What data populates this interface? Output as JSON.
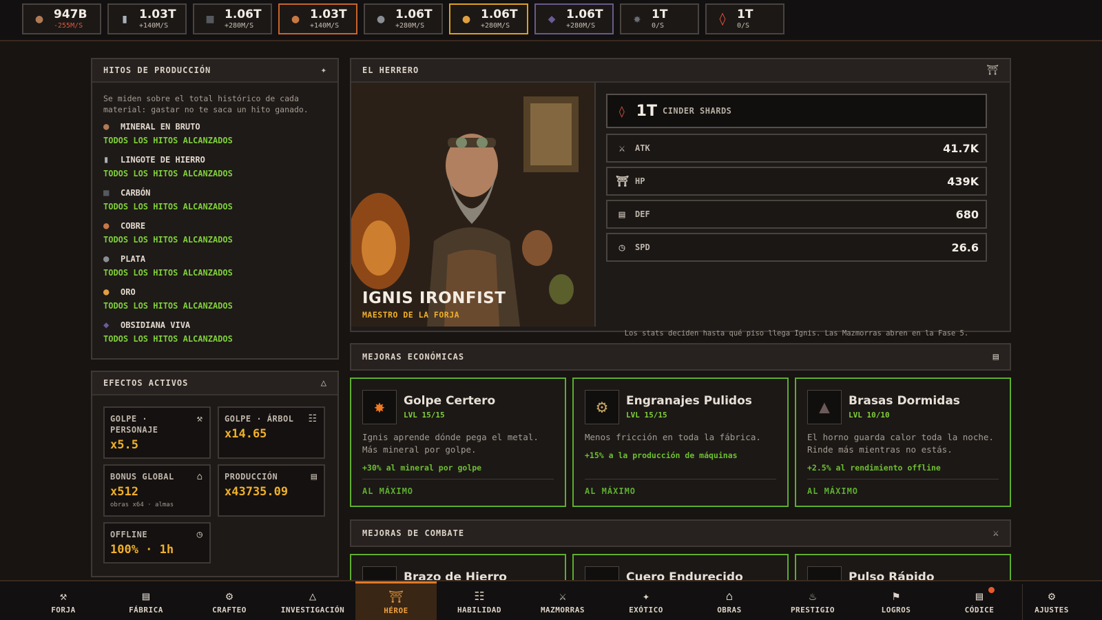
{
  "resources": [
    {
      "icon": "raw-ore-icon",
      "amount": "947B",
      "rate": "-255M/S",
      "negative": true,
      "border": "#4a4440"
    },
    {
      "icon": "iron-ingot-icon",
      "amount": "1.03T",
      "rate": "+140M/S",
      "negative": false,
      "border": "#4a4440"
    },
    {
      "icon": "coal-icon",
      "amount": "1.06T",
      "rate": "+280M/S",
      "negative": false,
      "border": "#4a4440"
    },
    {
      "icon": "copper-icon",
      "amount": "1.03T",
      "rate": "+140M/S",
      "negative": false,
      "border": "#c9642a"
    },
    {
      "icon": "silver-icon",
      "amount": "1.06T",
      "rate": "+280M/S",
      "negative": false,
      "border": "#4a4440"
    },
    {
      "icon": "gold-icon",
      "amount": "1.06T",
      "rate": "+280M/S",
      "negative": false,
      "border": "#e0a020"
    },
    {
      "icon": "obsidian-icon",
      "amount": "1.06T",
      "rate": "+280M/S",
      "negative": false,
      "border": "#6a5a8a"
    },
    {
      "icon": "gear-shard-icon",
      "amount": "1T",
      "rate": "0/S",
      "negative": false,
      "border": "#4a4440"
    },
    {
      "icon": "cinder-shard-icon",
      "amount": "1T",
      "rate": "0/S",
      "negative": false,
      "border": "#4a4440"
    }
  ],
  "milestones": {
    "title": "HITOS DE PRODUCCIÓN",
    "note": "Se miden sobre el total histórico de cada material: gastar no te saca un hito ganado.",
    "items": [
      {
        "name": "MINERAL EN BRUTO",
        "status": "TODOS LOS HITOS ALCANZADOS"
      },
      {
        "name": "LINGOTE DE HIERRO",
        "status": "TODOS LOS HITOS ALCANZADOS"
      },
      {
        "name": "CARBÓN",
        "status": "TODOS LOS HITOS ALCANZADOS"
      },
      {
        "name": "COBRE",
        "status": "TODOS LOS HITOS ALCANZADOS"
      },
      {
        "name": "PLATA",
        "status": "TODOS LOS HITOS ALCANZADOS"
      },
      {
        "name": "ORO",
        "status": "TODOS LOS HITOS ALCANZADOS"
      },
      {
        "name": "OBSIDIANA VIVA",
        "status": "TODOS LOS HITOS ALCANZADOS"
      }
    ]
  },
  "effects": {
    "title": "EFECTOS ACTIVOS",
    "items": [
      {
        "label": "GOLPE · PERSONAJE",
        "value": "x5.5",
        "sub": ""
      },
      {
        "label": "GOLPE · ÁRBOL",
        "value": "x14.65",
        "sub": ""
      },
      {
        "label": "BONUS GLOBAL",
        "value": "x512",
        "sub": "obras x64 · almas"
      },
      {
        "label": "PRODUCCIÓN",
        "value": "x43735.09",
        "sub": ""
      },
      {
        "label": "OFFLINE",
        "value": "100% · 1h",
        "sub": ""
      }
    ]
  },
  "hero": {
    "panel_title": "EL HERRERO",
    "name": "IGNIS IRONFIST",
    "subtitle": "MAESTRO DE LA FORJA",
    "shards_value": "1T",
    "shards_label": "CINDER SHARDS",
    "stats": [
      {
        "key": "ATK",
        "value": "41.7K"
      },
      {
        "key": "HP",
        "value": "439K"
      },
      {
        "key": "DEF",
        "value": "680"
      },
      {
        "key": "SPD",
        "value": "26.6"
      }
    ],
    "note": "Los stats deciden hasta qué piso llega Ignis. Las Mazmorras abren en la Fase 5."
  },
  "economic": {
    "title": "MEJORAS ECONÓMICAS",
    "cards": [
      {
        "name": "Golpe Certero",
        "level": "LVL 15/15",
        "desc": "Ignis aprende dónde pega el metal. Más mineral por golpe.",
        "effect": "+30% al mineral por golpe",
        "state": "AL MÁXIMO"
      },
      {
        "name": "Engranajes Pulidos",
        "level": "LVL 15/15",
        "desc": "Menos fricción en toda la fábrica.",
        "effect": "+15% a la producción de máquinas",
        "state": "AL MÁXIMO"
      },
      {
        "name": "Brasas Dormidas",
        "level": "LVL 10/10",
        "desc": "El horno guarda calor toda la noche. Rinde más mientras no estás.",
        "effect": "+2.5% al rendimiento offline",
        "state": "AL MÁXIMO"
      }
    ]
  },
  "combat": {
    "title": "MEJORAS DE COMBATE",
    "cards": [
      {
        "name": "Brazo de Hierro"
      },
      {
        "name": "Cuero Endurecido"
      },
      {
        "name": "Pulso Rápido"
      }
    ]
  },
  "nav": [
    {
      "label": "FORJA",
      "icon": "hammer-icon"
    },
    {
      "label": "FÁBRICA",
      "icon": "factory-icon"
    },
    {
      "label": "CRAFTEO",
      "icon": "cog-icon"
    },
    {
      "label": "INVESTIGACIÓN",
      "icon": "flask-icon"
    },
    {
      "label": "HÉROE",
      "icon": "helmet-icon"
    },
    {
      "label": "HABILIDAD",
      "icon": "tree-icon"
    },
    {
      "label": "MAZMORRAS",
      "icon": "swords-icon"
    },
    {
      "label": "EXÓTICO",
      "icon": "sparkle-icon"
    },
    {
      "label": "OBRAS",
      "icon": "building-icon"
    },
    {
      "label": "PRESTIGIO",
      "icon": "flame-icon"
    },
    {
      "label": "LOGROS",
      "icon": "flag-icon"
    },
    {
      "label": "CÓDICE",
      "icon": "book-icon"
    },
    {
      "label": "AJUSTES",
      "icon": "settings-icon"
    }
  ],
  "colors": {
    "accent": "#f0b02a",
    "success": "#7fcf3a",
    "active_tab": "#e07a2a",
    "danger": "#e0573e"
  }
}
